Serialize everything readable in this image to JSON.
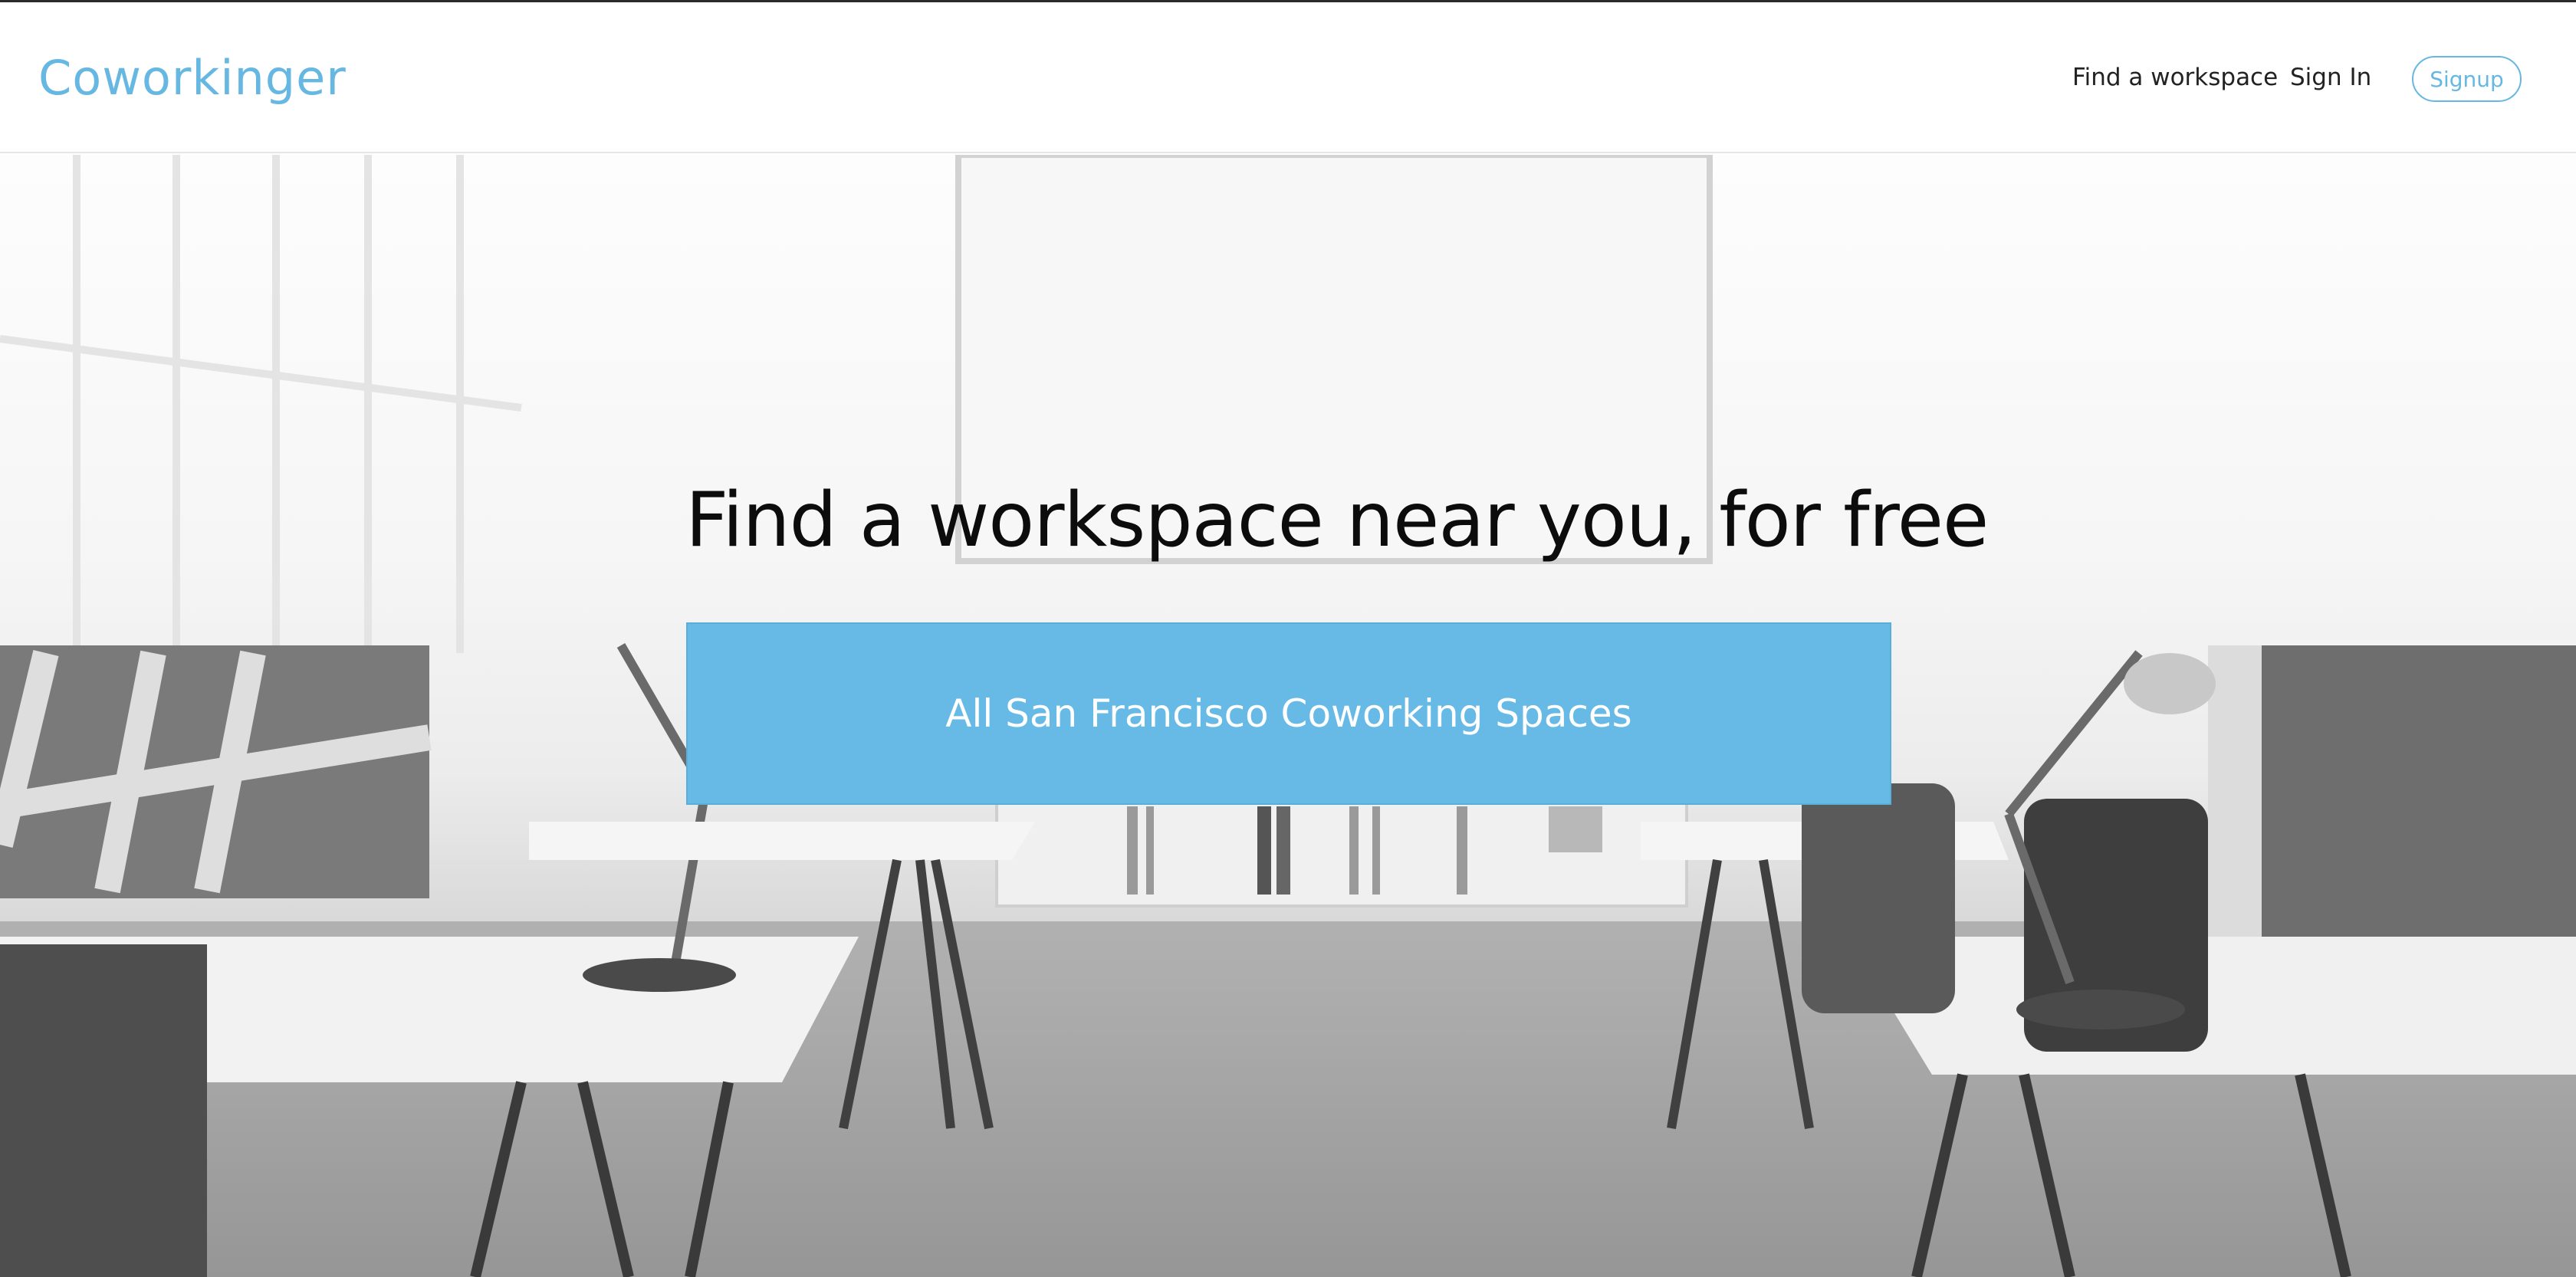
{
  "brand": {
    "name": "Coworkinger"
  },
  "nav": {
    "find_workspace": "Find a workspace",
    "sign_in": "Sign In",
    "signup": "Signup"
  },
  "hero": {
    "title": "Find a workspace near you, for free",
    "cta_label": "All San Francisco Coworking Spaces",
    "background_image": "office-interior-photo"
  },
  "colors": {
    "accent": "#66b8e2",
    "cta_background": "#67bae5",
    "title_text": "#0c0c0c",
    "nav_text": "#222222"
  }
}
